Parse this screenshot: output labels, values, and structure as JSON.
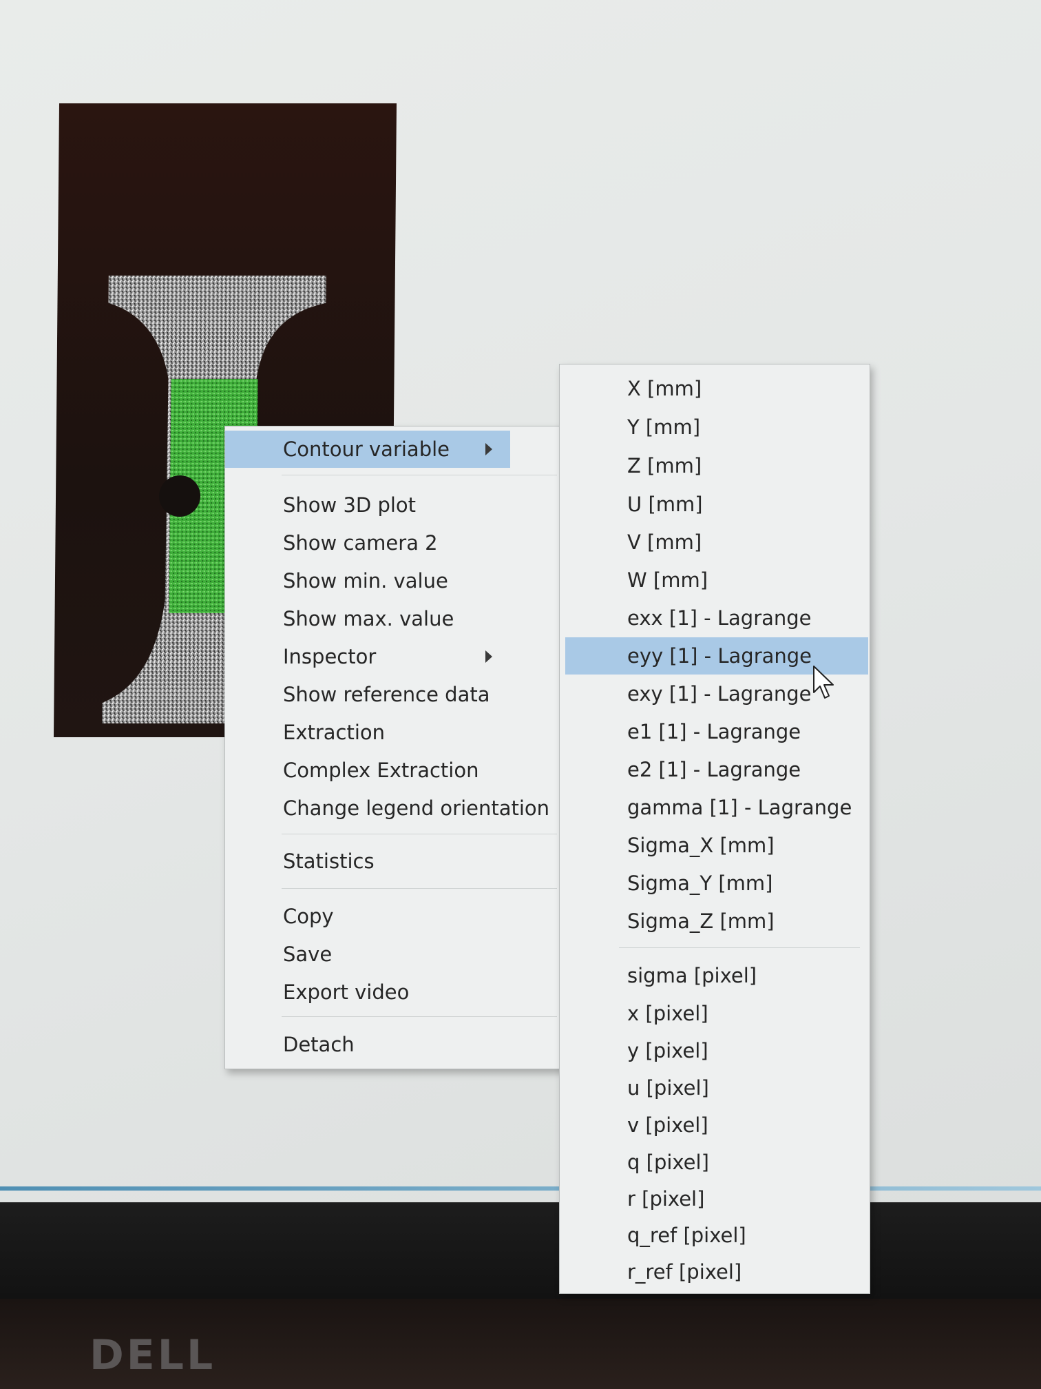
{
  "main_menu": {
    "items": [
      {
        "label": "Contour variable",
        "submenu": true,
        "highlighted": true
      },
      {
        "label": "Show 3D plot"
      },
      {
        "label": "Show camera 2"
      },
      {
        "label": "Show min. value"
      },
      {
        "label": "Show max. value"
      },
      {
        "label": "Inspector",
        "submenu": true
      },
      {
        "label": "Show reference data"
      },
      {
        "label": "Extraction"
      },
      {
        "label": "Complex Extraction"
      },
      {
        "label": "Change legend orientation"
      },
      {
        "label": "Statistics"
      },
      {
        "label": "Copy"
      },
      {
        "label": "Save"
      },
      {
        "label": "Export video"
      },
      {
        "label": "Detach"
      }
    ]
  },
  "contour_submenu": {
    "items": [
      {
        "label": "X [mm]"
      },
      {
        "label": "Y [mm]"
      },
      {
        "label": "Z [mm]"
      },
      {
        "label": "U [mm]"
      },
      {
        "label": "V [mm]"
      },
      {
        "label": "W [mm]"
      },
      {
        "label": "exx [1] - Lagrange"
      },
      {
        "label": "eyy [1] - Lagrange",
        "highlighted": true
      },
      {
        "label": "exy [1] - Lagrange"
      },
      {
        "label": "e1 [1] - Lagrange"
      },
      {
        "label": "e2 [1] - Lagrange"
      },
      {
        "label": "gamma [1] - Lagrange"
      },
      {
        "label": "Sigma_X [mm]"
      },
      {
        "label": "Sigma_Y [mm]"
      },
      {
        "label": "Sigma_Z [mm]"
      },
      {
        "label": "sigma [pixel]"
      },
      {
        "label": "x [pixel]"
      },
      {
        "label": "y [pixel]"
      },
      {
        "label": "u [pixel]"
      },
      {
        "label": "v [pixel]"
      },
      {
        "label": "q [pixel]"
      },
      {
        "label": "r [pixel]"
      },
      {
        "label": "q_ref [pixel]"
      },
      {
        "label": "r_ref [pixel]"
      }
    ]
  },
  "brand": "DELL",
  "colors": {
    "highlight": "#a9c9e6",
    "menu_bg": "#eef0f0",
    "strain_overlay": "#3fae3a",
    "specimen_speckle": "#bdbdbd"
  }
}
